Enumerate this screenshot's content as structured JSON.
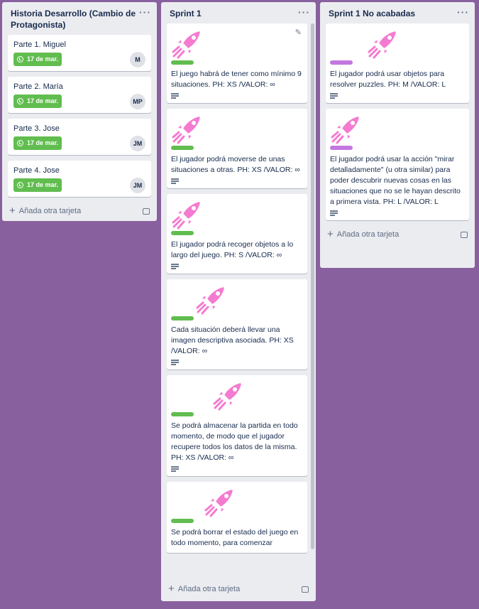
{
  "colors": {
    "board_bg": "#89609e",
    "label_green": "#61bd4f",
    "label_purple": "#c377e0",
    "due_green": "#61bd4f"
  },
  "lists": [
    {
      "title": "Historia Desarrollo (Cambio de Protagonista)",
      "menu": "···",
      "add_card": "Añada otra tarjeta",
      "cards": [
        {
          "title": "Parte 1. Miguel",
          "due": "17 de mar.",
          "avatar": "M"
        },
        {
          "title": "Parte 2. María",
          "due": "17 de mar.",
          "avatar": "MP"
        },
        {
          "title": "Parte 3. Jose",
          "due": "17 de mar.",
          "avatar": "JM"
        },
        {
          "title": "Parte 4. Jose",
          "due": "17 de mar.",
          "avatar": "JM"
        }
      ]
    },
    {
      "title": "Sprint 1",
      "menu": "···",
      "add_card": "Añada otra tarjeta",
      "edit_icon": "pencil-icon",
      "cards": [
        {
          "text": "El juego habrá de tener como mínimo 9 situaciones. PH: XS /VALOR: ∞",
          "label": "green"
        },
        {
          "text": "El jugador podrá moverse de unas situaciones a otras. PH: XS /VALOR: ∞",
          "label": "green"
        },
        {
          "text": "El jugador podrá recoger objetos a lo largo del juego. PH: S /VALOR: ∞",
          "label": "green"
        },
        {
          "text": "Cada situación deberá llevar una imagen descriptiva asociada. PH: XS /VALOR: ∞",
          "label": "green"
        },
        {
          "text": "Se podrá almacenar la partida en todo momento, de modo que el jugador recupere todos los datos de la misma. PH: XS /VALOR: ∞",
          "label": "green"
        },
        {
          "text": "Se podrá borrar el estado del juego en todo momento, para comenzar",
          "label": "green"
        }
      ]
    },
    {
      "title": "Sprint 1 No acabadas",
      "menu": "···",
      "add_card": "Añada otra tarjeta",
      "cards": [
        {
          "text": "El jugador podrá usar objetos para resolver puzzles. PH: M /VALOR: L",
          "label": "purple"
        },
        {
          "text": "El jugador podrá usar la acción \"mirar detalladamente\" (u otra similar) para poder descubrir nuevas cosas en las situaciones que no se le hayan descrito a primera vista. PH: L /VALOR: L",
          "label": "purple"
        }
      ]
    }
  ]
}
